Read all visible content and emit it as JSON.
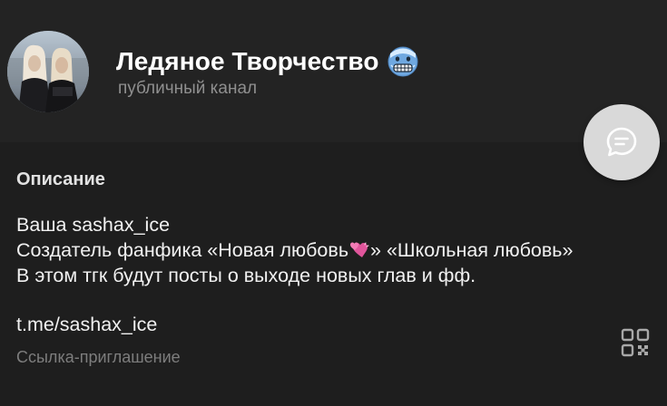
{
  "header": {
    "avatar_alt": "channel-avatar",
    "title": "Ледяное Творчество",
    "title_emoji": "cold-face-emoji",
    "subtitle": "публичный канал",
    "message_button_icon": "chat-bubble-icon"
  },
  "info": {
    "description_label": "Описание",
    "description_lines": [
      "Ваша  sashax_ice",
      "Создатель фанфика «Новая любовь",
      "» «Школьная любовь»",
      "В этом тгк будут посты о выходе новых глав и фф."
    ],
    "heart_emoji": "two-hearts-emoji",
    "link_value": "t.me/sashax_ice",
    "link_caption": "Ссылка-приглашение",
    "qr_icon": "qr-code-icon"
  },
  "colors": {
    "background": "#1e1e1e",
    "header_background": "#232323",
    "title": "#ffffff",
    "subtitle": "#8f8f8f",
    "fab": "#d9d9d9",
    "heart": "#e0559b"
  }
}
